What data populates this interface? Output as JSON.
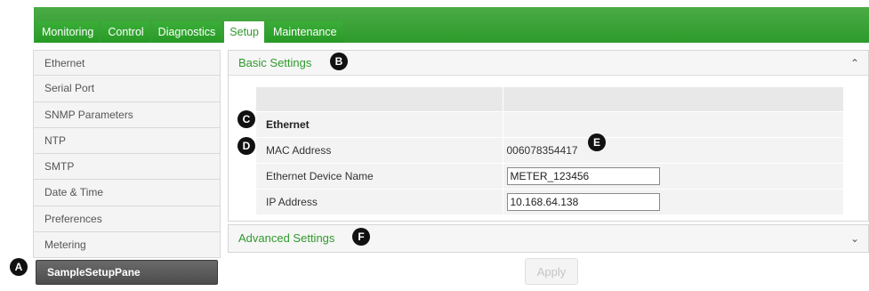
{
  "tabs": [
    {
      "label": "Monitoring"
    },
    {
      "label": "Control"
    },
    {
      "label": "Diagnostics"
    },
    {
      "label": "Setup",
      "active": true
    },
    {
      "label": "Maintenance"
    }
  ],
  "sidebar": {
    "items": [
      {
        "label": "Ethernet"
      },
      {
        "label": "Serial Port"
      },
      {
        "label": "SNMP Parameters"
      },
      {
        "label": "NTP"
      },
      {
        "label": "SMTP"
      },
      {
        "label": "Date & Time"
      },
      {
        "label": "Preferences"
      },
      {
        "label": "Metering"
      },
      {
        "label": "SampleSetupPane",
        "active": true
      }
    ]
  },
  "basic_settings": {
    "title": "Basic Settings",
    "collapse_icon": "chevron-up-icon",
    "section_label": "Ethernet",
    "mac_label": "MAC Address",
    "mac_value": "006078354417",
    "device_name_label": "Ethernet Device Name",
    "device_name_value": "METER_123456",
    "ip_label": "IP Address",
    "ip_value": "10.168.64.138"
  },
  "advanced_settings": {
    "title": "Advanced Settings",
    "expand_icon": "chevron-down-icon"
  },
  "apply_label": "Apply",
  "callouts": {
    "a": "A",
    "b": "B",
    "c": "C",
    "d": "D",
    "e": "E",
    "f": "F"
  },
  "colors": {
    "accent_green": "#2f9a2d",
    "topbar_green": "#3faa3b",
    "active_sidebar": "#555555"
  }
}
